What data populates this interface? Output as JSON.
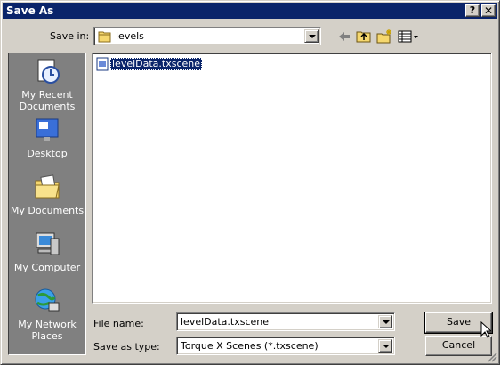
{
  "window": {
    "title": "Save As"
  },
  "title_buttons": {
    "help": "?",
    "close": "✕"
  },
  "save_in": {
    "label": "Save in:",
    "value": "levels"
  },
  "toolbar_icons": [
    "back-arrow-icon",
    "up-folder-icon",
    "new-folder-icon",
    "views-menu-icon"
  ],
  "places": [
    {
      "label": "My Recent Documents",
      "icon": "recent-documents-icon"
    },
    {
      "label": "Desktop",
      "icon": "desktop-icon"
    },
    {
      "label": "My Documents",
      "icon": "my-documents-icon"
    },
    {
      "label": "My Computer",
      "icon": "my-computer-icon"
    },
    {
      "label": "My Network Places",
      "icon": "network-places-icon"
    }
  ],
  "files": [
    {
      "name": "levelData.txscene",
      "selected": true
    }
  ],
  "file_name": {
    "label": "File name:",
    "value": "levelData.txscene"
  },
  "save_as_type": {
    "label": "Save as type:",
    "value": "Torque X Scenes (*.txscene)"
  },
  "buttons": {
    "save": "Save",
    "cancel": "Cancel"
  },
  "colors": {
    "titlebar": "#0a246a",
    "face": "#d4d0c8",
    "places_bg": "#808080",
    "selection": "#0a246a"
  }
}
